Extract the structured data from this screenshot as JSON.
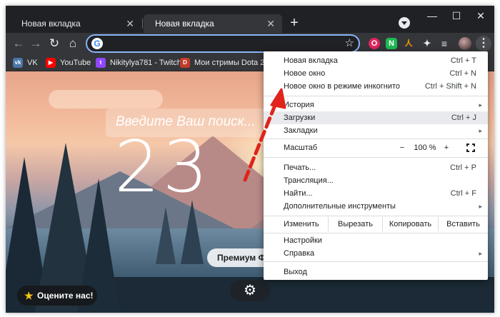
{
  "tabs": [
    {
      "label": "Новая вкладка",
      "close": "✕"
    },
    {
      "label": "Новая вкладка",
      "close": "✕"
    }
  ],
  "new_tab_glyph": "+",
  "window_controls": {
    "minimize": "—",
    "maximize": "☐",
    "close": "✕"
  },
  "toolbar": {
    "back": "←",
    "forward": "→",
    "reload": "↻",
    "home": "⌂",
    "omnibox_value": "",
    "omnibox_placeholder": "",
    "google_glyph": "G",
    "star": "☆",
    "menu_glyph": "⋮"
  },
  "extensions": [
    {
      "name": "opera-ext-icon",
      "glyph": "O",
      "color": "#e0245e"
    },
    {
      "name": "notes-ext-icon",
      "glyph": "N",
      "color": "#1db954"
    },
    {
      "name": "figure-ext-icon",
      "glyph": "人",
      "color": "#f29900"
    },
    {
      "name": "puzzle-icon",
      "glyph": "✦",
      "color": "#5f6368"
    },
    {
      "name": "playlist-icon",
      "glyph": "≡",
      "color": "#5f6368"
    }
  ],
  "bookmarks": [
    {
      "label": "VK",
      "icon": "vk-icon",
      "color": "#4a76a8",
      "glyph": "vk"
    },
    {
      "label": "YouTube",
      "icon": "youtube-icon",
      "color": "#ff0000",
      "glyph": "▶"
    },
    {
      "label": "Nikitylya781 - Twitch",
      "icon": "twitch-icon",
      "color": "#9146ff",
      "glyph": "t"
    },
    {
      "label": "Мои стримы Dota 2",
      "icon": "dota-icon",
      "color": "#c23c2a",
      "glyph": "D"
    }
  ],
  "newtab": {
    "search_placeholder": "Введите Ваш поиск...",
    "clock": "23",
    "premium_button": "Премиум Фу",
    "rate_button": "Оцените нас!",
    "rate_star": "★",
    "gear": "⚙"
  },
  "menu": {
    "items_top": [
      {
        "label": "Новая вкладка",
        "shortcut": "Ctrl + T"
      },
      {
        "label": "Новое окно",
        "shortcut": "Ctrl + N"
      },
      {
        "label": "Новое окно в режиме инкогнито",
        "shortcut": "Ctrl + Shift + N"
      }
    ],
    "items_mid": [
      {
        "label": "История",
        "arrow": "▸"
      },
      {
        "label": "Загрузки",
        "shortcut": "Ctrl + J"
      },
      {
        "label": "Закладки",
        "arrow": "▸"
      }
    ],
    "zoom": {
      "label": "Масштаб",
      "minus": "−",
      "value": "100 %",
      "plus": "+"
    },
    "items_low": [
      {
        "label": "Печать...",
        "shortcut": "Ctrl + P"
      },
      {
        "label": "Трансляция..."
      },
      {
        "label": "Найти...",
        "shortcut": "Ctrl + F"
      },
      {
        "label": "Дополнительные инструменты",
        "arrow": "▸"
      }
    ],
    "edit": {
      "label": "Изменить",
      "cut": "Вырезать",
      "copy": "Копировать",
      "paste": "Вставить"
    },
    "settings": "Настройки",
    "help": "Справка",
    "help_arrow": "▸",
    "exit": "Выход"
  },
  "colors": {
    "accent": "#8ab4f8",
    "annotation_arrow": "#e0241b"
  }
}
